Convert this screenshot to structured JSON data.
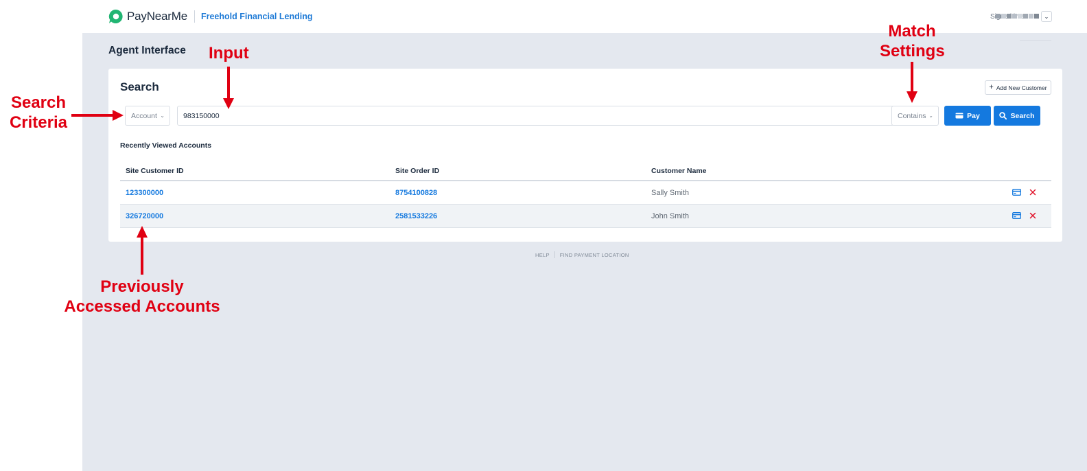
{
  "header": {
    "brand": "PayNearMe",
    "merchant": "Freehold Financial Lending",
    "signed_in_label": "Signed in as",
    "brand_color": "#22b573",
    "link_color": "#1e7ad6"
  },
  "page": {
    "title": "Agent Interface"
  },
  "search_card": {
    "title": "Search",
    "add_customer_label": "Add New Customer",
    "criteria_select": {
      "selected": "Account"
    },
    "input": {
      "value": "983150000"
    },
    "match_select": {
      "selected": "Contains"
    },
    "pay_label": "Pay",
    "search_label": "Search",
    "primary_color": "#1479df"
  },
  "recent": {
    "title": "Recently Viewed Accounts",
    "columns": [
      "Site Customer ID",
      "Site Order ID",
      "Customer Name"
    ],
    "rows": [
      {
        "customer_id": "123300000",
        "order_id": "8754100828",
        "name": "Sally Smith"
      },
      {
        "customer_id": "326720000",
        "order_id": "2581533226",
        "name": "John Smith"
      }
    ]
  },
  "footer": {
    "links": [
      "HELP",
      "FIND PAYMENT LOCATION"
    ]
  },
  "annotations": {
    "input": "Input",
    "match_line1": "Match",
    "match_line2": "Settings",
    "criteria_line1": "Search",
    "criteria_line2": "Criteria",
    "previous_line1": "Previously",
    "previous_line2": "Accessed Accounts",
    "color": "#e00012"
  }
}
